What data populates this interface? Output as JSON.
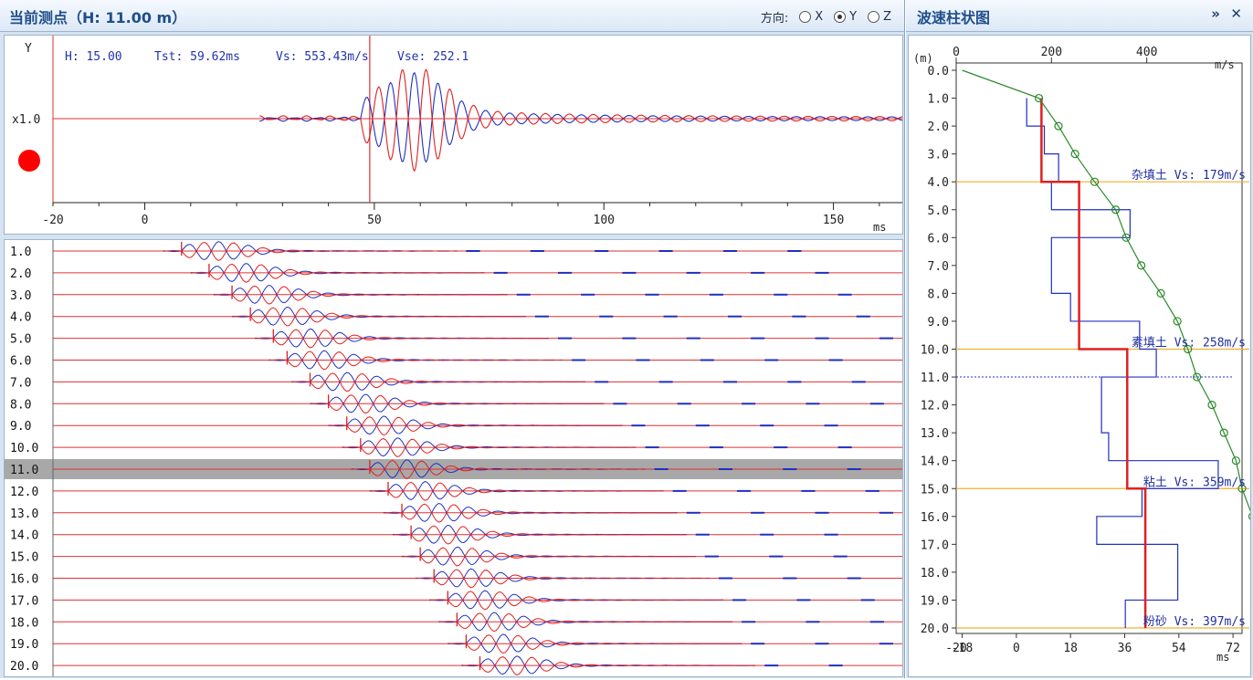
{
  "left_panel": {
    "title": "当前测点（H: 11.00 m）",
    "direction_label": "方向:",
    "directions": [
      {
        "label": "X",
        "selected": false
      },
      {
        "label": "Y",
        "selected": true
      },
      {
        "label": "Z",
        "selected": false
      }
    ]
  },
  "wave_detail": {
    "channel": "Y",
    "gain": "x1.0",
    "info": {
      "h": "H: 15.00",
      "tst": "Tst: 59.62ms",
      "vs": "Vs: 553.43m/s",
      "vse": "Vse: 252.1"
    },
    "marker_ms": 49,
    "x_ticks": [
      "-20",
      "0",
      "50",
      "100",
      "150"
    ],
    "x_unit": "ms",
    "record_indicator_color": "#ff0000"
  },
  "trace_list": {
    "depths": [
      "1.0",
      "2.0",
      "3.0",
      "4.0",
      "5.0",
      "6.0",
      "7.0",
      "8.0",
      "9.0",
      "10.0",
      "11.0",
      "12.0",
      "13.0",
      "14.0",
      "15.0",
      "16.0",
      "17.0",
      "18.0",
      "19.0",
      "20.0"
    ],
    "selected_depth": "11.0",
    "first_arrival_ms": [
      8,
      14,
      19,
      23,
      28,
      31,
      36,
      40,
      44,
      47,
      49,
      53,
      56,
      58,
      60,
      63,
      66,
      68,
      70,
      73
    ]
  },
  "right_panel": {
    "title": "波速柱状图",
    "expand_button": "»",
    "close_button": "✕",
    "depth_unit": "(m)",
    "depth_ticks": [
      "0.0",
      "1.0",
      "2.0",
      "3.0",
      "4.0",
      "5.0",
      "6.0",
      "7.0",
      "8.0",
      "9.0",
      "10.0",
      "11.0",
      "12.0",
      "13.0",
      "14.0",
      "15.0",
      "16.0",
      "17.0",
      "18.0",
      "19.0",
      "20.0"
    ],
    "vs_ticks": [
      "0",
      "200",
      "400"
    ],
    "vs_unit": "m/s",
    "time_ticks": [
      "-18",
      "0",
      "18",
      "36",
      "54",
      "72"
    ],
    "time_extra_tick": "-20",
    "time_unit": "ms",
    "layers": [
      {
        "name": "杂填土",
        "vs_text": "Vs: 179m/s",
        "top": 0,
        "bottom": 4,
        "vs": 179
      },
      {
        "name": "素填土",
        "vs_text": "Vs: 258m/s",
        "top": 4,
        "bottom": 10,
        "vs": 258
      },
      {
        "name": "粘土",
        "vs_text": "Vs: 359m/s",
        "top": 10,
        "bottom": 15,
        "vs": 359
      },
      {
        "name": "粉砂",
        "vs_text": "Vs: 397m/s",
        "top": 15,
        "bottom": 20,
        "vs": 397
      }
    ],
    "interval_vs": [
      {
        "top": 1,
        "bottom": 2,
        "vs": 148
      },
      {
        "top": 2,
        "bottom": 3,
        "vs": 185
      },
      {
        "top": 3,
        "bottom": 4,
        "vs": 215
      },
      {
        "top": 4,
        "bottom": 5,
        "vs": 200
      },
      {
        "top": 5,
        "bottom": 6,
        "vs": 365
      },
      {
        "top": 6,
        "bottom": 8,
        "vs": 200
      },
      {
        "top": 8,
        "bottom": 9,
        "vs": 240
      },
      {
        "top": 9,
        "bottom": 10,
        "vs": 385
      },
      {
        "top": 10,
        "bottom": 11,
        "vs": 420
      },
      {
        "top": 11,
        "bottom": 13,
        "vs": 305
      },
      {
        "top": 13,
        "bottom": 14,
        "vs": 320
      },
      {
        "top": 14,
        "bottom": 15,
        "vs": 550
      },
      {
        "top": 15,
        "bottom": 16,
        "vs": 390
      },
      {
        "top": 16,
        "bottom": 17,
        "vs": 295
      },
      {
        "top": 17,
        "bottom": 19,
        "vs": 465
      },
      {
        "top": 19,
        "bottom": 20,
        "vs": 355
      }
    ],
    "time_depth_curve_ms": [
      -18,
      7.5,
      14,
      19.5,
      26,
      33,
      36.5,
      41.5,
      48,
      53.5,
      57,
      60,
      65,
      69,
      73,
      75,
      78.5,
      82,
      85,
      87.5,
      89
    ],
    "current_depth": 11.0,
    "colors": {
      "layer_line": "#f0b030",
      "vs_column": "#e02020",
      "interval": "#2030c0",
      "curve": "#2a8a2a"
    }
  }
}
